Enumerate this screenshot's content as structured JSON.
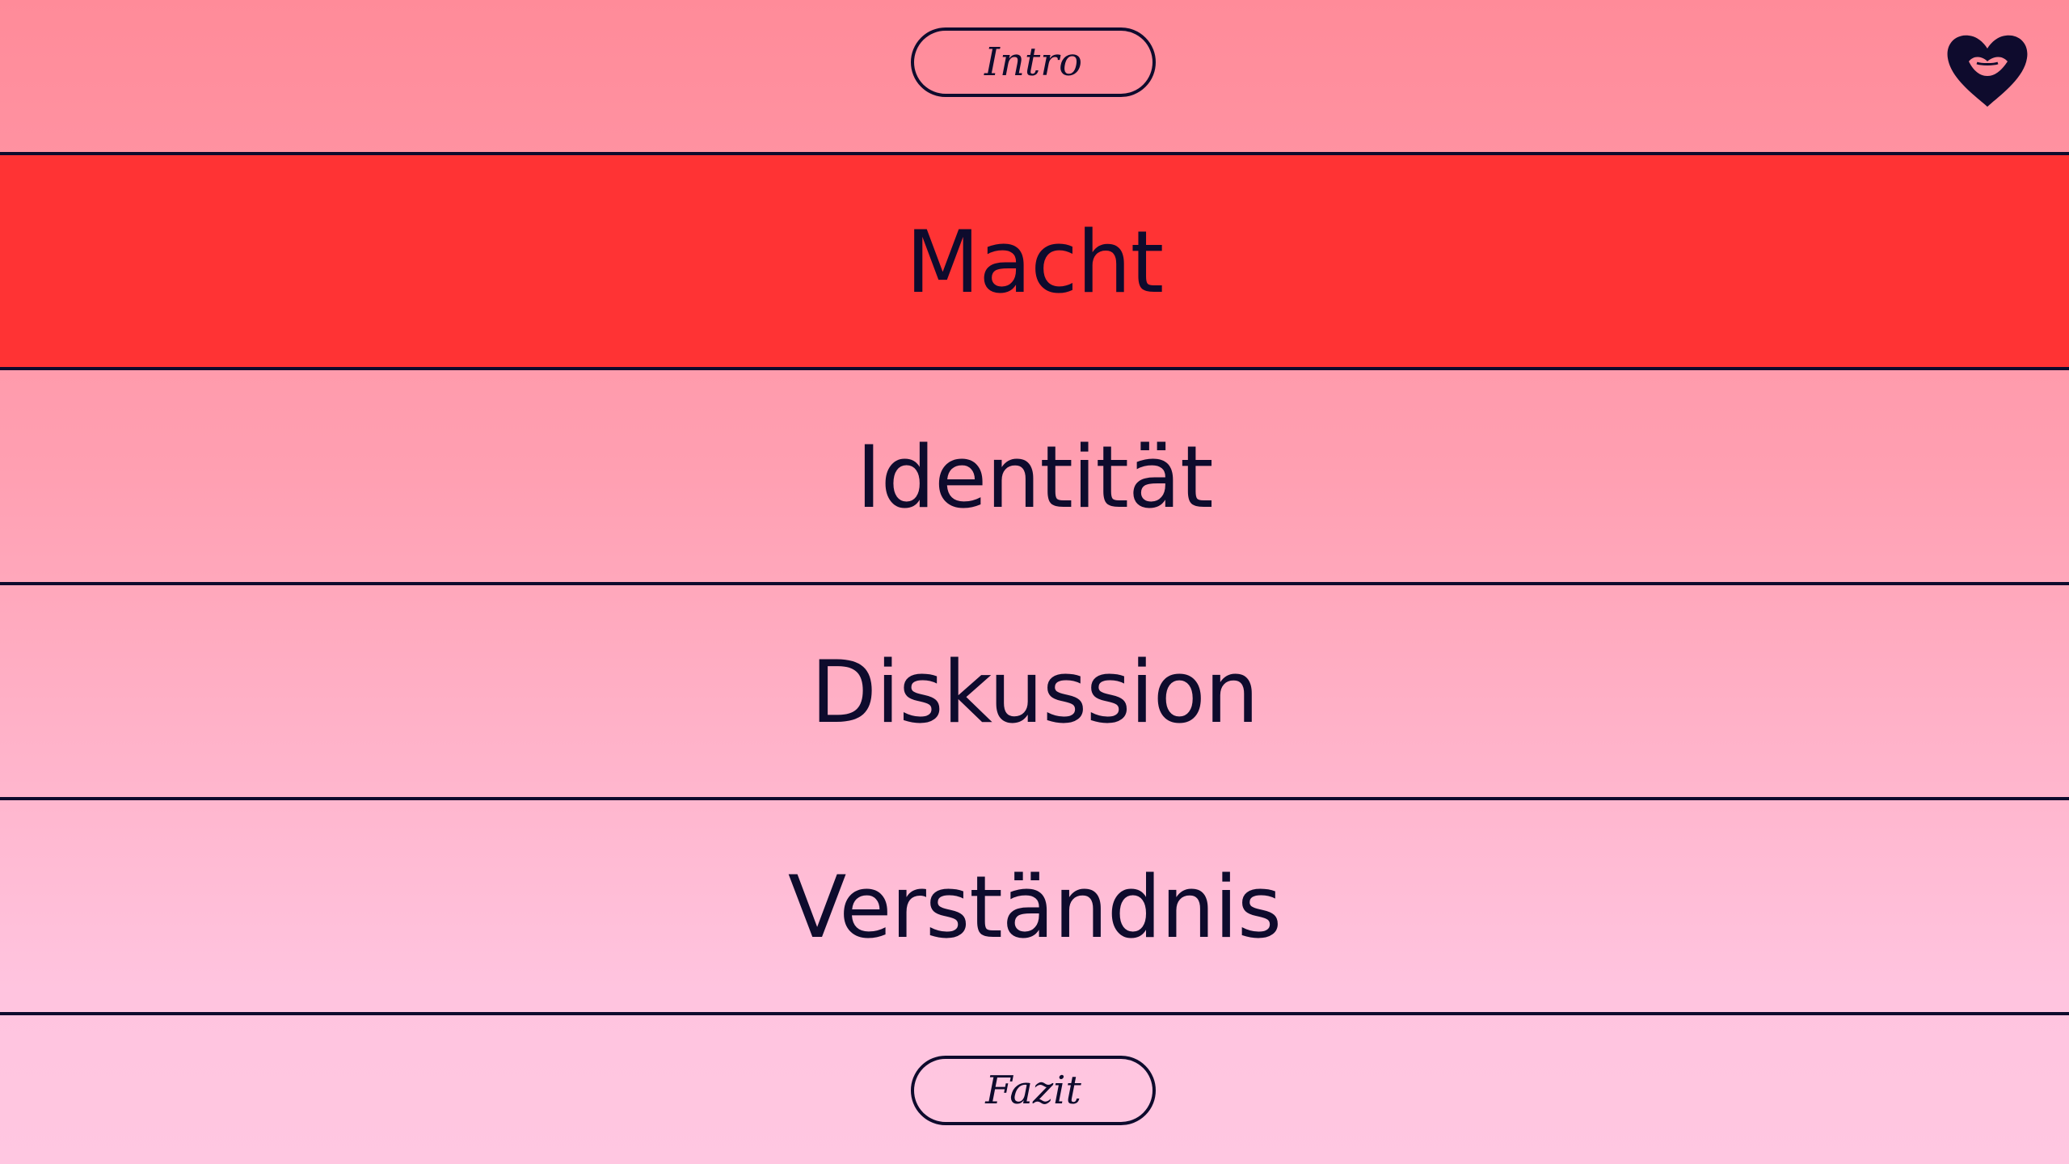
{
  "header": {
    "intro_label": "Intro",
    "logo_icon": "heart-lips-logo-icon"
  },
  "topics": [
    {
      "label": "Macht",
      "active": true,
      "color": "#ff3334"
    },
    {
      "label": "Identität",
      "active": false
    },
    {
      "label": "Diskussion",
      "active": false
    },
    {
      "label": "Verständnis",
      "active": false
    }
  ],
  "footer": {
    "fazit_label": "Fazit"
  },
  "colors": {
    "ink": "#0e0b2d",
    "active_row": "#ff3334",
    "gradient_top": "#ff8b99",
    "gradient_bottom": "#ffc7e1"
  }
}
